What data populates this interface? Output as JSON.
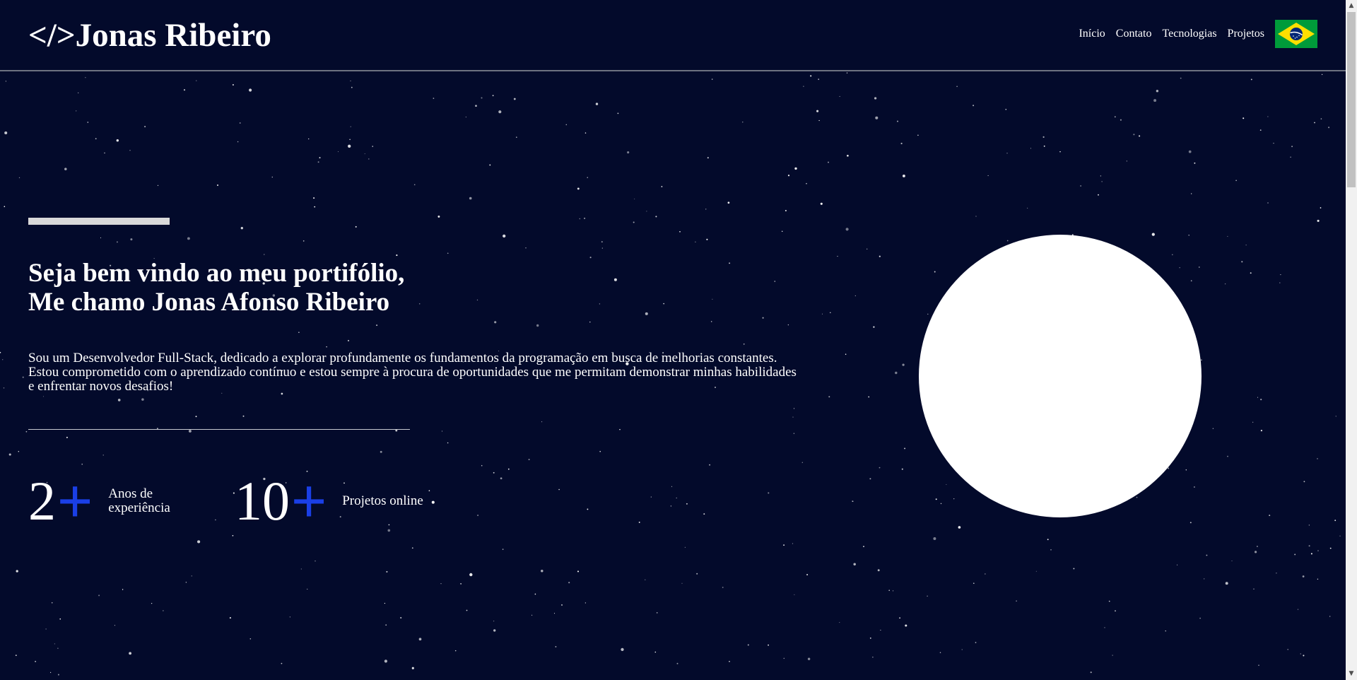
{
  "header": {
    "logo": "</>Jonas Ribeiro",
    "nav": {
      "inicio": "Início",
      "contato": "Contato",
      "tecnologias": "Tecnologias",
      "projetos": "Projetos"
    },
    "language_flag": "brazil-flag-icon"
  },
  "hero": {
    "headline_line1": "Seja bem vindo ao meu portifólio,",
    "headline_line2": "Me chamo Jonas Afonso Ribeiro",
    "intro": "Sou um Desenvolvedor Full-Stack, dedicado a explorar profundamente os fundamentos da programação em busca de melhorias constantes. Estou comprometido com o aprendizado contínuo e estou sempre à procura de oportunidades que me permitam demonstrar minhas habilidades e enfrentar novos desafios!",
    "stats": [
      {
        "number": "2",
        "plus": "+",
        "label": "Anos de experiência"
      },
      {
        "number": "10",
        "plus": "+",
        "label": "Projetos online"
      }
    ]
  },
  "scrollbar": {
    "up_arrow": "▲",
    "down_arrow": "▼"
  },
  "colors": {
    "background": "#030a2b",
    "accent_blue": "#1a3fe6",
    "text": "#ffffff",
    "flag_green": "#009b3a",
    "flag_yellow": "#fedf00",
    "flag_blue": "#002776"
  }
}
